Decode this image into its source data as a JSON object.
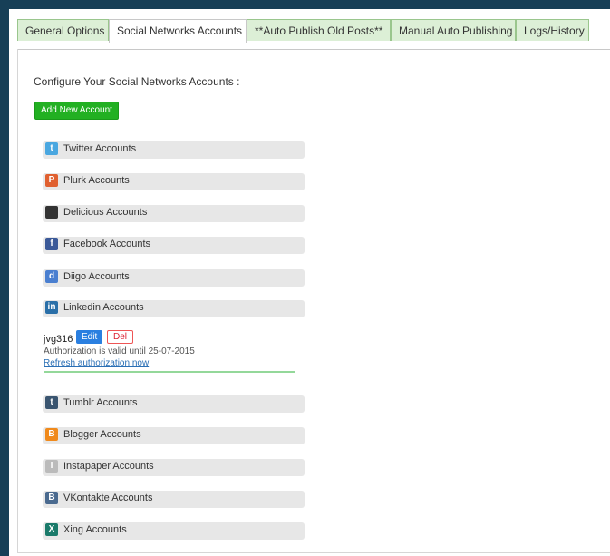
{
  "tabs": [
    {
      "label": "General Options"
    },
    {
      "label": "Social Networks Accounts"
    },
    {
      "label": "**Auto Publish Old Posts**"
    },
    {
      "label": "Manual Auto Publishing"
    },
    {
      "label": "Logs/History"
    }
  ],
  "panel": {
    "heading": "Configure Your Social Networks Accounts :",
    "add_button": "Add New Account"
  },
  "accounts": [
    {
      "label": "Twitter Accounts",
      "icon": "twitter-icon",
      "color": "#4aa7e0",
      "glyph": "t"
    },
    {
      "label": "Plurk Accounts",
      "icon": "plurk-icon",
      "color": "#e06030",
      "glyph": "P"
    },
    {
      "label": "Delicious Accounts",
      "icon": "delicious-icon",
      "color": "#333333",
      "glyph": ""
    },
    {
      "label": "Facebook Accounts",
      "icon": "facebook-icon",
      "color": "#3b5998",
      "glyph": "f"
    },
    {
      "label": "Diigo Accounts",
      "icon": "diigo-icon",
      "color": "#4a7fd0",
      "glyph": "d"
    },
    {
      "label": "Linkedin Accounts",
      "icon": "linkedin-icon",
      "color": "#2a6fa8",
      "glyph": "in"
    },
    {
      "label": "Tumblr Accounts",
      "icon": "tumblr-icon",
      "color": "#3a5570",
      "glyph": "t"
    },
    {
      "label": "Blogger Accounts",
      "icon": "blogger-icon",
      "color": "#f08a1c",
      "glyph": "B"
    },
    {
      "label": "Instapaper Accounts",
      "icon": "instapaper-icon",
      "color": "#bbbbbb",
      "glyph": "I"
    },
    {
      "label": "VKontakte Accounts",
      "icon": "vkontakte-icon",
      "color": "#4a6a8f",
      "glyph": "B"
    },
    {
      "label": "Xing Accounts",
      "icon": "xing-icon",
      "color": "#1a7a6a",
      "glyph": "X"
    }
  ],
  "linkedin_user": {
    "name": "jvg316",
    "edit_label": "Edit",
    "del_label": "Del",
    "auth_note": "Authorization is valid until 25-07-2015",
    "refresh_link": "Refresh authorization now"
  }
}
